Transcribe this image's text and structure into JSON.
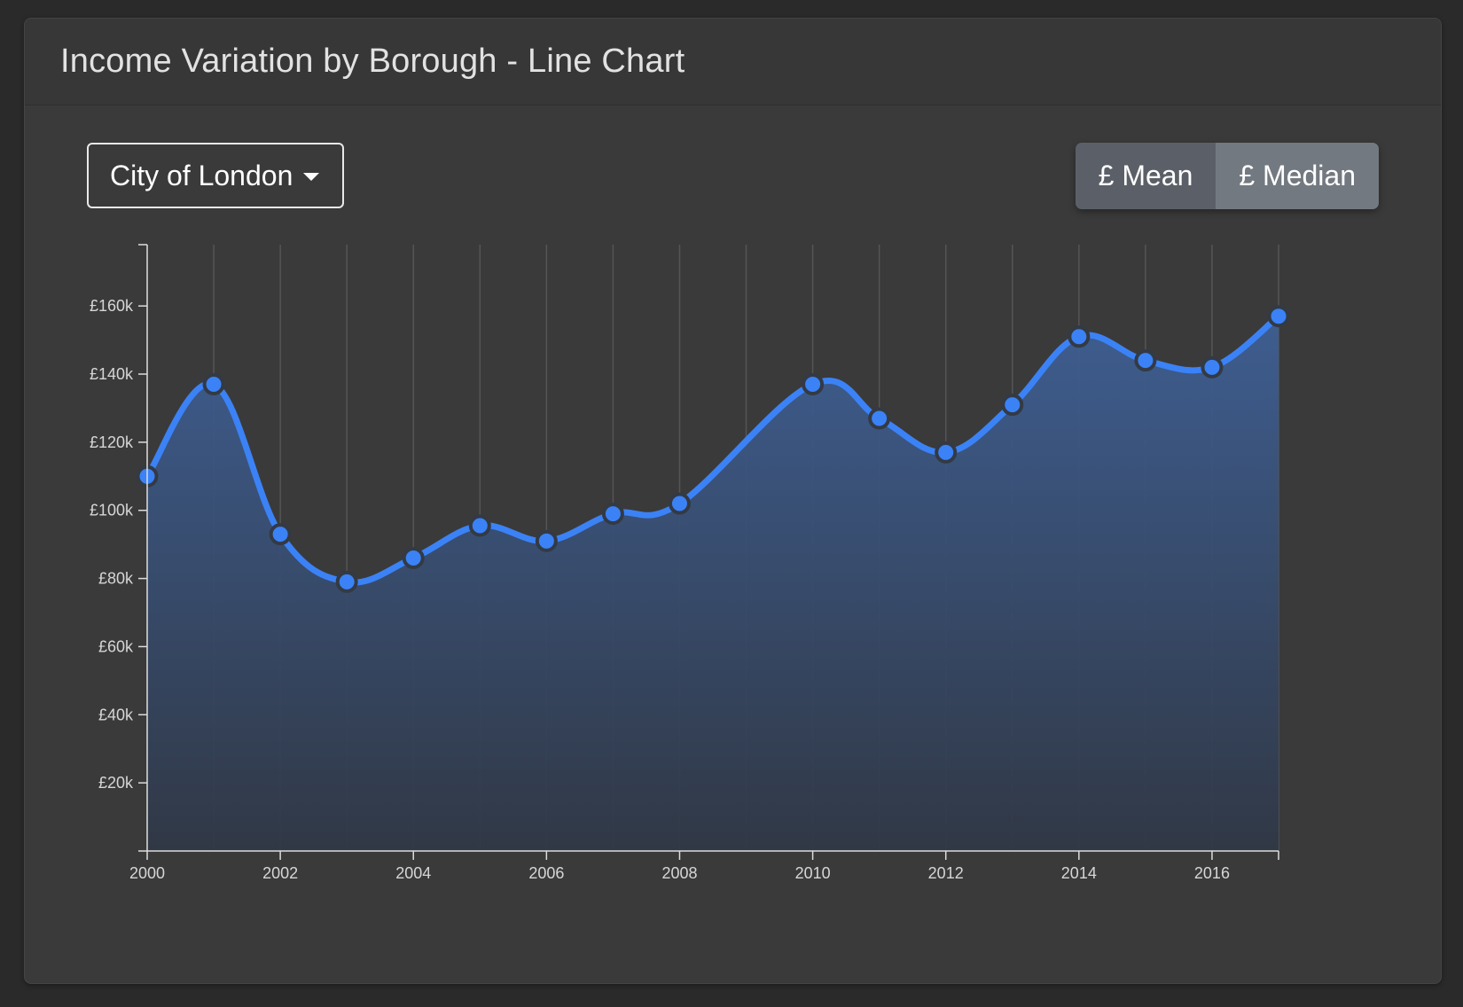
{
  "header": {
    "title": "Income Variation by Borough - Line Chart"
  },
  "controls": {
    "borough_dropdown": "City of London",
    "toggle": {
      "mean_label": "£ Mean",
      "median_label": "£ Median"
    }
  },
  "colors": {
    "line": "#3b82f6",
    "area_top": "#3e5f94",
    "area_bottom": "#303846",
    "grid": "#555555"
  },
  "chart_data": {
    "type": "area",
    "title": "Income Variation by Borough - Line Chart",
    "x": [
      2000,
      2001,
      2002,
      2003,
      2004,
      2005,
      2006,
      2007,
      2008,
      2009,
      2010,
      2011,
      2012,
      2013,
      2014,
      2015,
      2016,
      2017
    ],
    "series": [
      {
        "values": [
          110000,
          137000,
          93000,
          79000,
          86000,
          95500,
          91000,
          99000,
          102000,
          null,
          137000,
          127000,
          117000,
          131000,
          151000,
          144000,
          142000,
          157000
        ]
      }
    ],
    "xlim": [
      2000,
      2017
    ],
    "ylim": [
      0,
      178000
    ],
    "x_tick_labels": [
      "2000",
      "2002",
      "2004",
      "2006",
      "2008",
      "2010",
      "2012",
      "2014",
      "2016"
    ],
    "y_tick_labels": [
      "£20k",
      "£40k",
      "£60k",
      "£80k",
      "£100k",
      "£120k",
      "£140k",
      "£160k"
    ],
    "grid": "vertical",
    "curve": "smooth"
  }
}
